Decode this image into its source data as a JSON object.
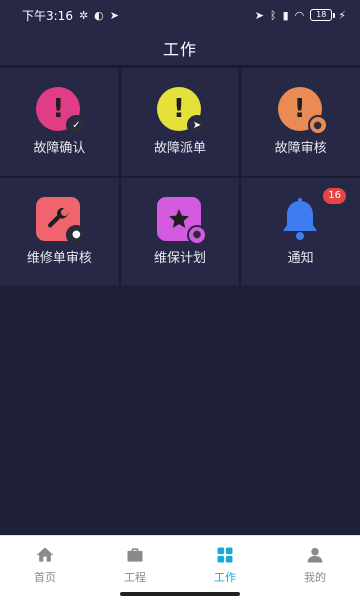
{
  "status_bar": {
    "time": "下午3:16",
    "battery": "18"
  },
  "header": {
    "title": "工作"
  },
  "grid": [
    {
      "label": "故障确认",
      "color": "#e13d87",
      "symbol": "!",
      "badge_icon": "check-icon"
    },
    {
      "label": "故障派单",
      "color": "#e6e03a",
      "symbol": "!",
      "badge_icon": "send-icon"
    },
    {
      "label": "故障审核",
      "color": "#ea8b53",
      "symbol": "!",
      "badge_icon": "person-icon"
    },
    {
      "label": "维修单审核",
      "color": "#f0646e",
      "symbol": "wrench",
      "badge_icon": "person-icon"
    },
    {
      "label": "维保计划",
      "color": "#d45ae0",
      "symbol": "star",
      "badge_icon": "person-icon"
    },
    {
      "label": "通知",
      "color": "#3f7ef0",
      "symbol": "bell",
      "badge": "16"
    }
  ],
  "tabbar": {
    "tabs": [
      {
        "label": "首页",
        "icon": "home-icon",
        "active": false
      },
      {
        "label": "工程",
        "icon": "briefcase-icon",
        "active": false
      },
      {
        "label": "工作",
        "icon": "grid-icon",
        "active": true
      },
      {
        "label": "我的",
        "icon": "user-icon",
        "active": false
      }
    ],
    "active_color": "#1aa9d6"
  }
}
